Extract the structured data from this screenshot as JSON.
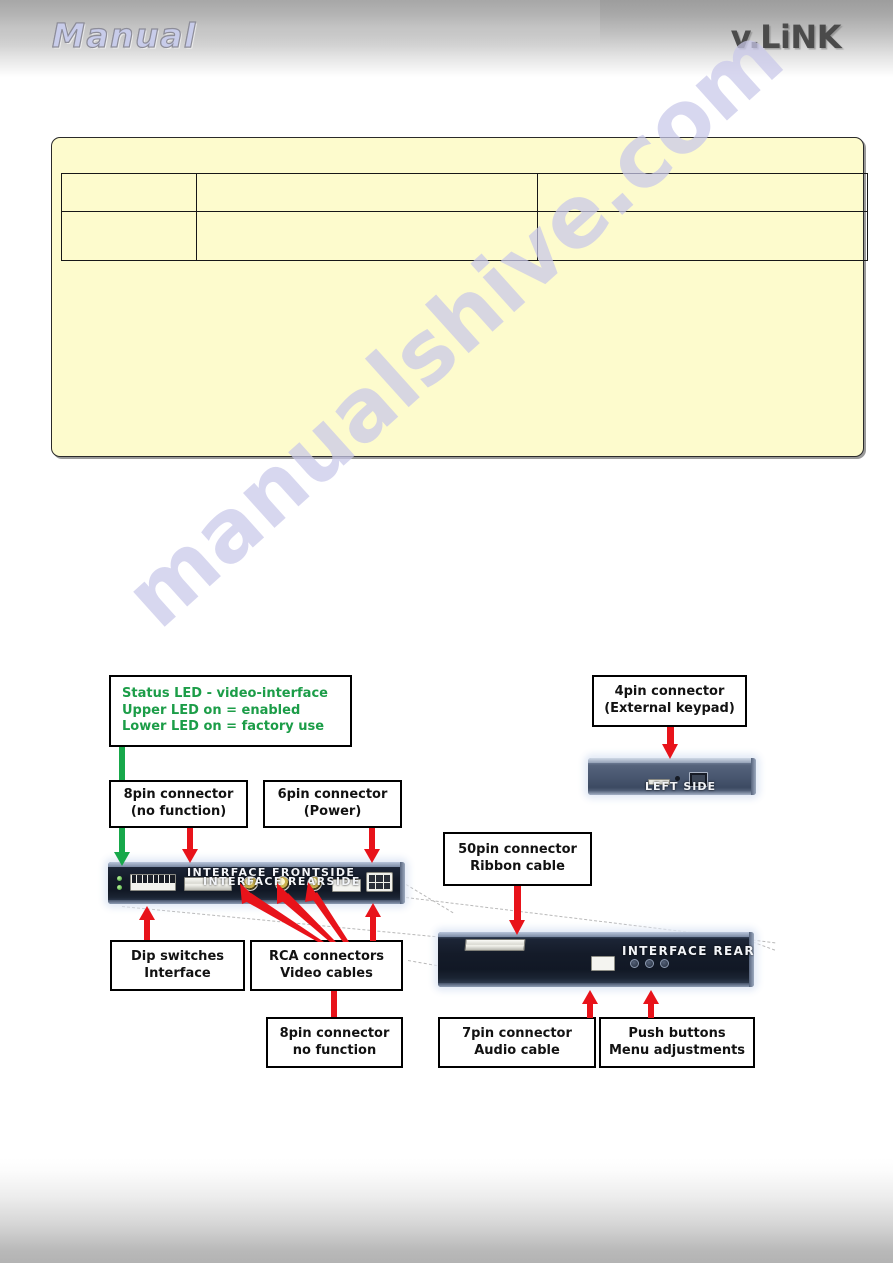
{
  "header": {
    "left_title": "Manual",
    "brand": "v.LiNK"
  },
  "watermark": {
    "text": "manualshive.com"
  },
  "note_box": {
    "table": {
      "rows": [
        {
          "cells": [
            "",
            "",
            ""
          ]
        },
        {
          "cells": [
            "",
            "",
            ""
          ]
        }
      ]
    }
  },
  "diagram": {
    "labels": {
      "status_led": {
        "line1": "Status LED - video-interface",
        "line2": "Upper LED on =  enabled",
        "line3": "Lower LED on =  factory use"
      },
      "pin8_top": {
        "line1": "8pin connector",
        "line2": "(no function)"
      },
      "pin6_power": {
        "line1": "6pin connector",
        "line2": "(Power)"
      },
      "pin4_keypad": {
        "line1": "4pin connector",
        "line2": "(External keypad)"
      },
      "pin50_ribbon": {
        "line1": "50pin connector",
        "line2": "Ribbon cable"
      },
      "dip_switches": {
        "line1": "Dip switches",
        "line2": "Interface"
      },
      "rca_connectors": {
        "line1": "RCA connectors",
        "line2": "Video cables"
      },
      "pin8_bottom": {
        "line1": "8pin connector",
        "line2": "no function"
      },
      "pin7_audio": {
        "line1": "7pin connector",
        "line2": "Audio cable"
      },
      "push_buttons": {
        "line1": "Push buttons",
        "line2": "Menu adjustments"
      }
    },
    "boards": {
      "frontside": {
        "caption_upper": "INTERFACE  FRONTSIDE",
        "caption_lower": "INTERFACE  REARSIDE"
      },
      "rearside": {
        "caption": "INTERFACE  REARSIDE"
      },
      "leftside": {
        "caption": "LEFT SIDE"
      }
    }
  },
  "colors": {
    "note_background": "#fdfbcd",
    "arrow_red": "#e8131a",
    "arrow_green": "#17a84a",
    "status_text_green": "#1c9d48",
    "watermark": "#c9c8ea"
  }
}
